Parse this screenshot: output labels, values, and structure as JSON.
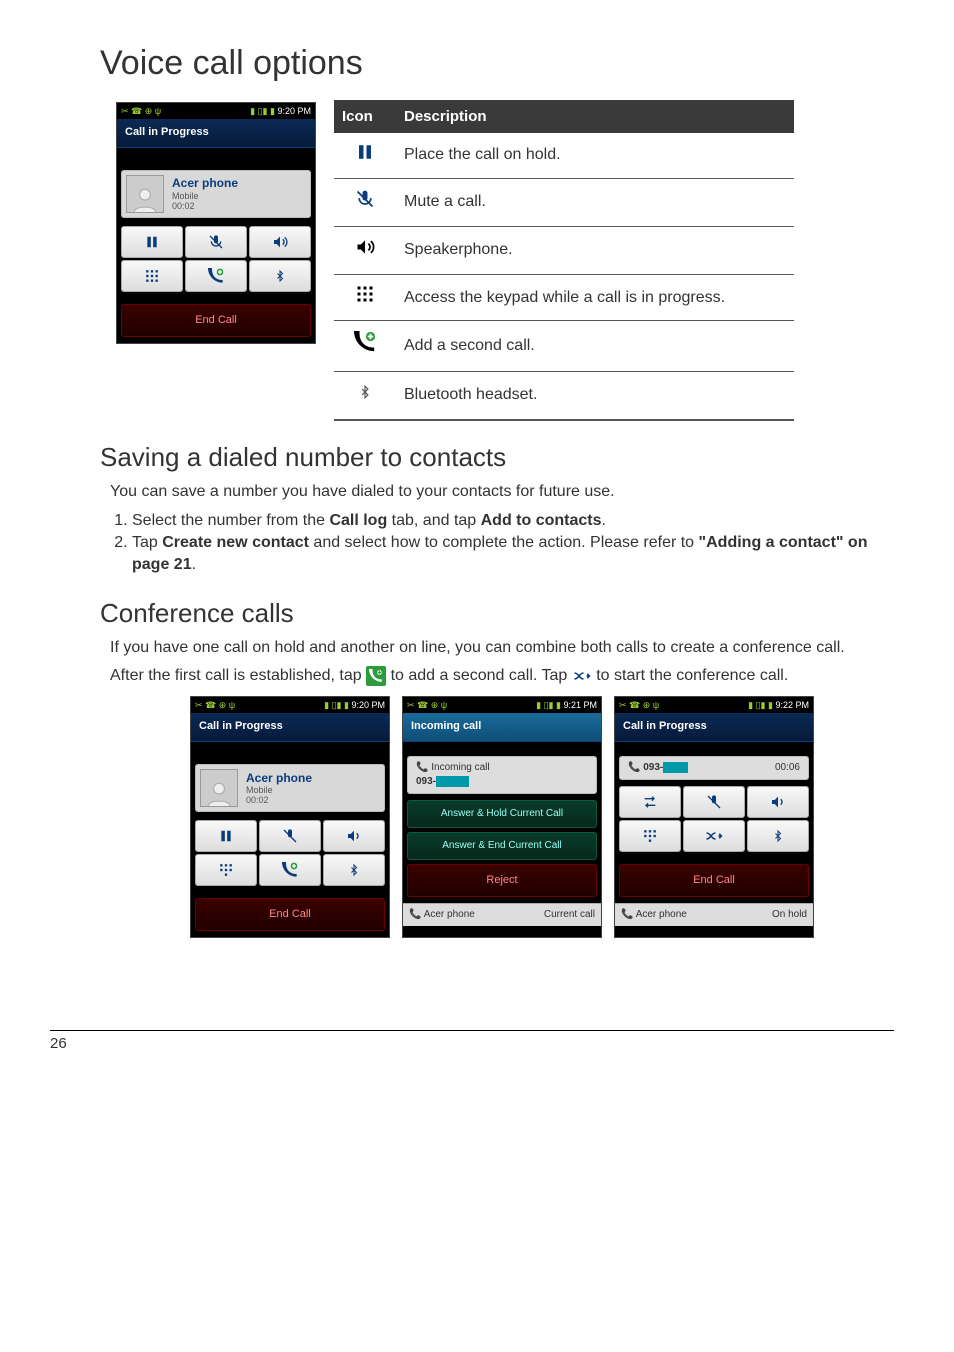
{
  "h1": "Voice call options",
  "h2a": "Saving a dialed number to contacts",
  "h2b": "Conference calls",
  "icon_table": {
    "col1": "Icon",
    "col2": "Description",
    "rows": [
      "Place the call on hold.",
      "Mute a call.",
      "Speakerphone.",
      "Access the keypad while a call is in progress.",
      "Add a second call.",
      "Bluetooth headset."
    ]
  },
  "save_intro": "You can save a number you have dialed to your contacts for future use.",
  "save_step1a": "Select the number from the ",
  "save_step1b": "Call log",
  "save_step1c": " tab, and tap ",
  "save_step1d": "Add to contacts",
  "save_step1e": ".",
  "save_step2a": "Tap ",
  "save_step2b": "Create new contact",
  "save_step2c": " and select how to complete the action. Please refer to ",
  "save_step2d": "\"Adding a contact\" on page 21",
  "save_step2e": ".",
  "conf_intro": "If you have one call on hold and another on line, you can combine both calls to create a conference call.",
  "conf_line_a": "After the first call is established, tap ",
  "conf_line_b": " to add a second call. Tap ",
  "conf_line_c": " to start the conference call.",
  "phone_common": {
    "status_icons_left": "✂ ☎ ⊕ ψ",
    "status_icons_right_signal": "▮ ▯▮ ▮"
  },
  "phone1": {
    "time": "9:20 PM",
    "title": "Call in Progress",
    "contact_name": "Acer phone",
    "contact_type": "Mobile",
    "duration": "00:02",
    "end_call": "End Call"
  },
  "phone2": {
    "time": "9:21 PM",
    "title": "Incoming call",
    "row_label": "Incoming call",
    "number": "093-",
    "btn_hold": "Answer & Hold Current Call",
    "btn_end": "Answer & End Current Call",
    "btn_reject": "Reject",
    "bottom_left": "Acer phone",
    "bottom_right": "Current call"
  },
  "phone3": {
    "time": "9:22 PM",
    "title": "Call in Progress",
    "number": "093-",
    "duration": "00:06",
    "end_call": "End Call",
    "bottom_left": "Acer phone",
    "bottom_right": "On hold"
  },
  "page_number": "26"
}
